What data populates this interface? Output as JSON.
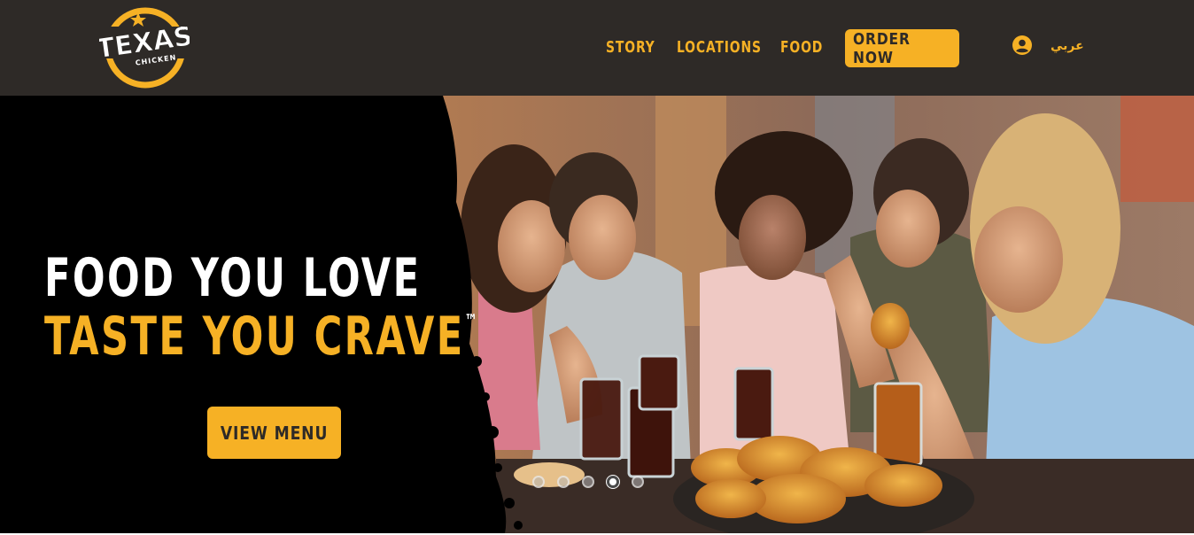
{
  "brand": {
    "logo_word": "TEXAS",
    "logo_sub": "CHICKEN",
    "logo_mark": "TM",
    "colors": {
      "header_bg": "#2e2a27",
      "accent": "#f6b125",
      "hero_bg": "#000000"
    }
  },
  "nav": {
    "story": "STORY",
    "locations": "LOCATIONS",
    "food": "FOOD",
    "order_now": "ORDER NOW",
    "language": "عربي",
    "account_icon": "user-circle-icon"
  },
  "hero": {
    "headline_line1": "FOOD YOU LOVE",
    "headline_line2": "TASTE YOU CRAVE",
    "trademark": "™",
    "cta": "VIEW MENU",
    "slides_count": 5,
    "active_slide": 4
  }
}
